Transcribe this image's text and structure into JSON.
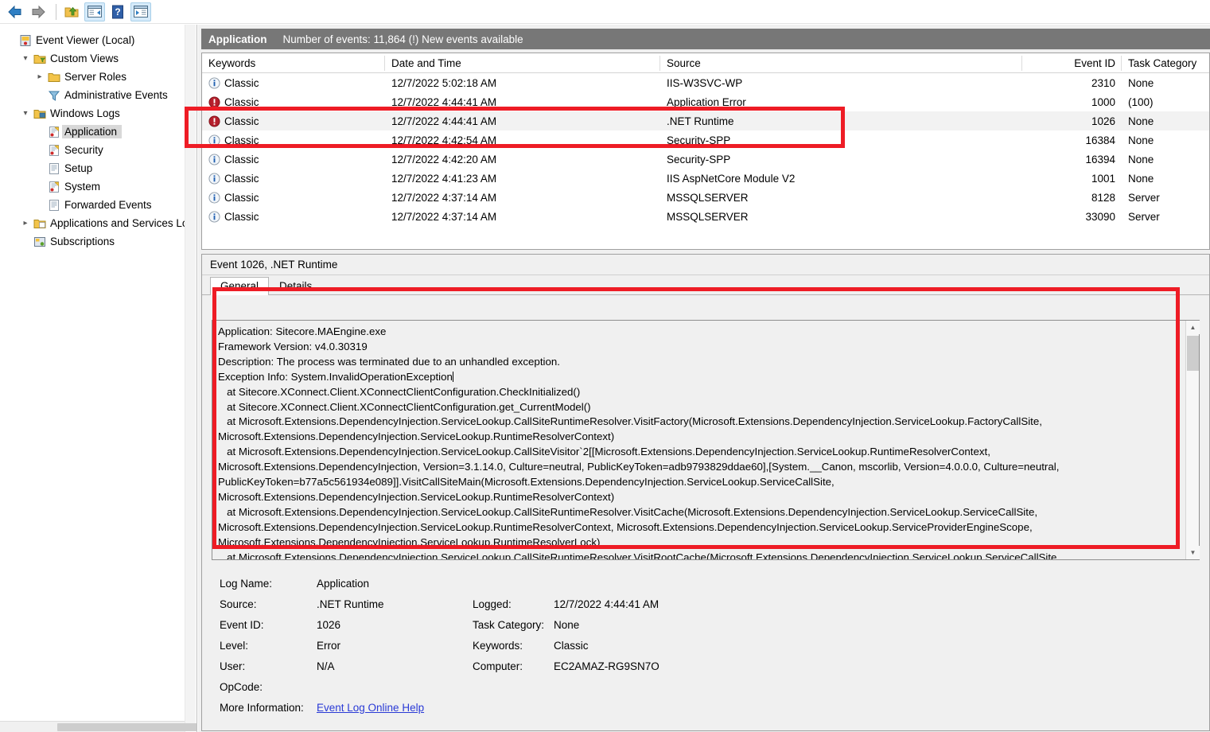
{
  "toolbar": {
    "buttons": [
      {
        "name": "back-button",
        "icon": "back-arrow-icon",
        "active": false
      },
      {
        "name": "forward-button",
        "icon": "forward-arrow-icon",
        "active": false
      },
      {
        "name": "up-one-level-button",
        "icon": "folder-up-icon",
        "active": false
      },
      {
        "name": "show-console-tree-button",
        "icon": "console-tree-icon",
        "active": true
      },
      {
        "name": "help-button",
        "icon": "help-question-icon",
        "active": false
      },
      {
        "name": "show-action-pane-button",
        "icon": "action-pane-icon",
        "active": true
      }
    ]
  },
  "tree": {
    "nodes": [
      {
        "label": "Event Viewer (Local)",
        "indent": 0,
        "twist": "",
        "icon": "event-viewer-icon",
        "selected": false
      },
      {
        "label": "Custom Views",
        "indent": 1,
        "twist": "expanded",
        "icon": "custom-views-folder-icon",
        "selected": false
      },
      {
        "label": "Server Roles",
        "indent": 2,
        "twist": "collapsed",
        "icon": "folder-icon",
        "selected": false
      },
      {
        "label": "Administrative Events",
        "indent": 2,
        "twist": "",
        "icon": "filter-funnel-icon",
        "selected": false
      },
      {
        "label": "Windows Logs",
        "indent": 1,
        "twist": "expanded",
        "icon": "windows-logs-folder-icon",
        "selected": false
      },
      {
        "label": "Application",
        "indent": 2,
        "twist": "",
        "icon": "log-warning-icon",
        "selected": true
      },
      {
        "label": "Security",
        "indent": 2,
        "twist": "",
        "icon": "log-warning-icon",
        "selected": false
      },
      {
        "label": "Setup",
        "indent": 2,
        "twist": "",
        "icon": "log-plain-icon",
        "selected": false
      },
      {
        "label": "System",
        "indent": 2,
        "twist": "",
        "icon": "log-warning-icon",
        "selected": false
      },
      {
        "label": "Forwarded Events",
        "indent": 2,
        "twist": "",
        "icon": "log-plain-icon",
        "selected": false
      },
      {
        "label": "Applications and Services Log",
        "indent": 1,
        "twist": "collapsed",
        "icon": "app-services-folder-icon",
        "selected": false
      },
      {
        "label": "Subscriptions",
        "indent": 1,
        "twist": "",
        "icon": "subscriptions-icon",
        "selected": false
      }
    ]
  },
  "list_title": {
    "log_name": "Application",
    "status": "Number of events: 11,864 (!) New events available"
  },
  "event_list": {
    "columns": [
      "Keywords",
      "Date and Time",
      "Source",
      "Event ID",
      "Task Category"
    ],
    "rows": [
      {
        "level": "information",
        "keywords": "Classic",
        "datetime": "12/7/2022 5:02:18 AM",
        "source": "IIS-W3SVC-WP",
        "event_id": "2310",
        "task_category": "None",
        "selected": false
      },
      {
        "level": "error",
        "keywords": "Classic",
        "datetime": "12/7/2022 4:44:41 AM",
        "source": "Application Error",
        "event_id": "1000",
        "task_category": "(100)",
        "selected": false
      },
      {
        "level": "error",
        "keywords": "Classic",
        "datetime": "12/7/2022 4:44:41 AM",
        "source": ".NET Runtime",
        "event_id": "1026",
        "task_category": "None",
        "selected": true
      },
      {
        "level": "information",
        "keywords": "Classic",
        "datetime": "12/7/2022 4:42:54 AM",
        "source": "Security-SPP",
        "event_id": "16384",
        "task_category": "None",
        "selected": false
      },
      {
        "level": "information",
        "keywords": "Classic",
        "datetime": "12/7/2022 4:42:20 AM",
        "source": "Security-SPP",
        "event_id": "16394",
        "task_category": "None",
        "selected": false
      },
      {
        "level": "information",
        "keywords": "Classic",
        "datetime": "12/7/2022 4:41:23 AM",
        "source": "IIS AspNetCore Module V2",
        "event_id": "1001",
        "task_category": "None",
        "selected": false
      },
      {
        "level": "information",
        "keywords": "Classic",
        "datetime": "12/7/2022 4:37:14 AM",
        "source": "MSSQLSERVER",
        "event_id": "8128",
        "task_category": "Server",
        "selected": false
      },
      {
        "level": "information",
        "keywords": "Classic",
        "datetime": "12/7/2022 4:37:14 AM",
        "source": "MSSQLSERVER",
        "event_id": "33090",
        "task_category": "Server",
        "selected": false
      }
    ]
  },
  "detail": {
    "header": "Event 1026, .NET Runtime",
    "tabs": [
      {
        "label": "General",
        "active": true
      },
      {
        "label": "Details",
        "active": false
      }
    ],
    "event_text": "Application: Sitecore.MAEngine.exe\nFramework Version: v4.0.30319\nDescription: The process was terminated due to an unhandled exception.\nException Info: System.InvalidOperationException\n   at Sitecore.XConnect.Client.XConnectClientConfiguration.CheckInitialized()\n   at Sitecore.XConnect.Client.XConnectClientConfiguration.get_CurrentModel()\n   at Microsoft.Extensions.DependencyInjection.ServiceLookup.CallSiteRuntimeResolver.VisitFactory(Microsoft.Extensions.DependencyInjection.ServiceLookup.FactoryCallSite, Microsoft.Extensions.DependencyInjection.ServiceLookup.RuntimeResolverContext)\n   at Microsoft.Extensions.DependencyInjection.ServiceLookup.CallSiteVisitor`2[[Microsoft.Extensions.DependencyInjection.ServiceLookup.RuntimeResolverContext, Microsoft.Extensions.DependencyInjection, Version=3.1.14.0, Culture=neutral, PublicKeyToken=adb9793829ddae60],[System.__Canon, mscorlib, Version=4.0.0.0, Culture=neutral, PublicKeyToken=b77a5c561934e089]].VisitCallSiteMain(Microsoft.Extensions.DependencyInjection.ServiceLookup.ServiceCallSite, Microsoft.Extensions.DependencyInjection.ServiceLookup.RuntimeResolverContext)\n   at Microsoft.Extensions.DependencyInjection.ServiceLookup.CallSiteRuntimeResolver.VisitCache(Microsoft.Extensions.DependencyInjection.ServiceLookup.ServiceCallSite, Microsoft.Extensions.DependencyInjection.ServiceLookup.RuntimeResolverContext, Microsoft.Extensions.DependencyInjection.ServiceLookup.ServiceProviderEngineScope, Microsoft.Extensions.DependencyInjection.ServiceLookup.RuntimeResolverLock)\n   at Microsoft.Extensions.DependencyInjection.ServiceLookup.CallSiteRuntimeResolver.VisitRootCache(Microsoft.Extensions.DependencyInjection.ServiceLookup.ServiceCallSite, Microsoft.Extensions.DependencyInjection.ServiceLookup.RuntimeResolverContext)",
    "fields": {
      "log_name_label": "Log Name:",
      "log_name_value": "Application",
      "source_label": "Source:",
      "source_value": ".NET Runtime",
      "event_id_label": "Event ID:",
      "event_id_value": "1026",
      "level_label": "Level:",
      "level_value": "Error",
      "user_label": "User:",
      "user_value": "N/A",
      "opcode_label": "OpCode:",
      "opcode_value": "",
      "more_info_label": "More Information:",
      "more_info_link": "Event Log Online Help",
      "logged_label": "Logged:",
      "logged_value": "12/7/2022 4:44:41 AM",
      "task_category_label": "Task Category:",
      "task_category_value": "None",
      "keywords_label": "Keywords:",
      "keywords_value": "Classic",
      "computer_label": "Computer:",
      "computer_value": "EC2AMAZ-RG9SN7O"
    }
  },
  "annotations": {
    "highlight_color": "#ee1c25",
    "boxes": [
      {
        "name": "highlight-selected-event-row"
      },
      {
        "name": "highlight-event-description-text"
      }
    ]
  }
}
